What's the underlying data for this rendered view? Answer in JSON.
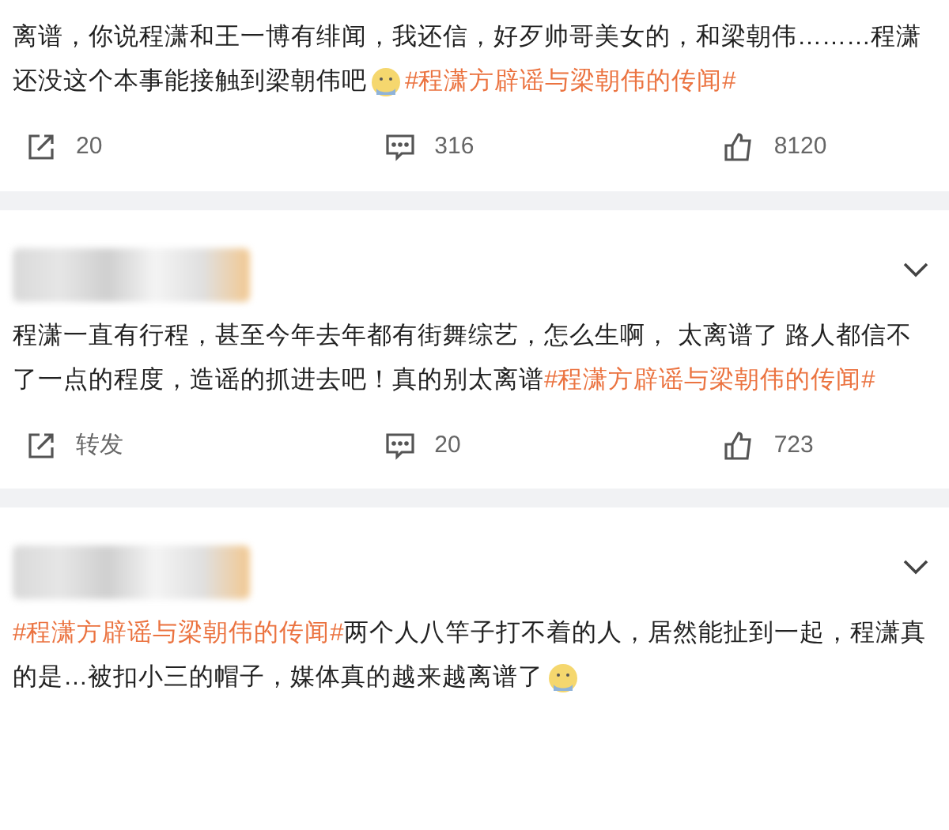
{
  "comments": [
    {
      "blurred_header": false,
      "segments": [
        {
          "kind": "text",
          "text": "离谱，你说程潇和王一博有绯闻，我还信，好歹帅哥美女的，和梁朝伟………程潇还没这个本事能接触到梁朝伟吧"
        },
        {
          "kind": "emoji"
        },
        {
          "kind": "hashtag",
          "text": "#程潇方辟谣与梁朝伟的传闻#"
        }
      ],
      "actions": {
        "share": "20",
        "comments": "316",
        "likes": "8120"
      }
    },
    {
      "blurred_header": true,
      "segments": [
        {
          "kind": "text",
          "text": "程潇一直有行程，甚至今年去年都有街舞综艺，怎么生啊， 太离谱了 路人都信不了一点的程度，造谣的抓进去吧！真的别太离谱"
        },
        {
          "kind": "hashtag",
          "text": "#程潇方辟谣与梁朝伟的传闻#"
        }
      ],
      "actions": {
        "share": "转发",
        "comments": "20",
        "likes": "723"
      }
    },
    {
      "blurred_header": true,
      "segments": [
        {
          "kind": "hashtag",
          "text": "#程潇方辟谣与梁朝伟的传闻#"
        },
        {
          "kind": "text",
          "text": "两个人八竿子打不着的人，居然能扯到一起，程潇真的是…被扣小三的帽子，媒体真的越来越离谱了"
        },
        {
          "kind": "emoji"
        }
      ]
    }
  ]
}
